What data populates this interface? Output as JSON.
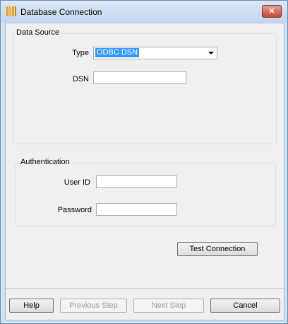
{
  "window": {
    "title": "Database Connection",
    "close_label": "✕"
  },
  "data_source": {
    "legend": "Data Source",
    "type_label": "Type",
    "type_value": "ODBC DSN",
    "dsn_label": "DSN",
    "dsn_value": ""
  },
  "authentication": {
    "legend": "Authentication",
    "user_id_label": "User ID",
    "user_id_value": "",
    "password_label": "Password",
    "password_value": ""
  },
  "buttons": {
    "test_connection": "Test Connection",
    "help": "Help",
    "previous_step": "Previous Step",
    "next_step": "Next Step",
    "cancel": "Cancel"
  }
}
